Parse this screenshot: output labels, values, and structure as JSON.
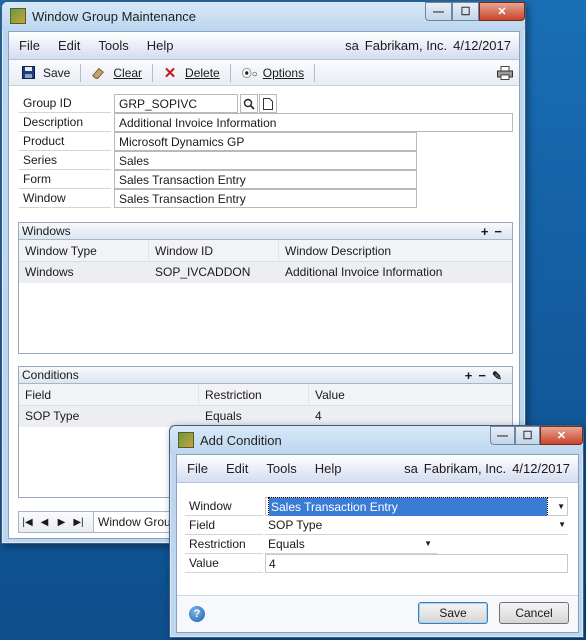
{
  "main": {
    "title": "Window Group Maintenance",
    "menu": [
      "File",
      "Edit",
      "Tools",
      "Help"
    ],
    "status": {
      "user": "sa",
      "company": "Fabrikam, Inc.",
      "date": "4/12/2017"
    },
    "toolbar": {
      "save": "Save",
      "clear": "Clear",
      "delete": "Delete",
      "options": "Options"
    },
    "fields": {
      "group_id_label": "Group ID",
      "group_id": "GRP_SOPIVC",
      "description_label": "Description",
      "description": "Additional Invoice Information",
      "product_label": "Product",
      "product": "Microsoft Dynamics GP",
      "series_label": "Series",
      "series": "Sales",
      "form_label": "Form",
      "form": "Sales Transaction Entry",
      "window_label": "Window",
      "window": "Sales Transaction Entry"
    },
    "windows_section": {
      "title": "Windows",
      "columns": [
        "Window Type",
        "Window ID",
        "Window Description"
      ],
      "rows": [
        {
          "type": "Windows",
          "id": "SOP_IVCADDON",
          "description": "Additional Invoice Information"
        }
      ]
    },
    "conditions_section": {
      "title": "Conditions",
      "columns": [
        "Field",
        "Restriction",
        "Value"
      ],
      "rows": [
        {
          "field": "SOP Type",
          "restriction": "Equals",
          "value": "4"
        }
      ]
    },
    "nav": {
      "label": "Window Group"
    }
  },
  "dialog": {
    "title": "Add Condition",
    "menu": [
      "File",
      "Edit",
      "Tools",
      "Help"
    ],
    "status": {
      "user": "sa",
      "company": "Fabrikam, Inc.",
      "date": "4/12/2017"
    },
    "window_label": "Window",
    "window_value": "Sales Transaction Entry",
    "field_label": "Field",
    "field_value": "SOP Type",
    "restriction_label": "Restriction",
    "restriction_value": "Equals",
    "value_label": "Value",
    "value_value": "4",
    "save_button": "Save",
    "cancel_button": "Cancel"
  }
}
